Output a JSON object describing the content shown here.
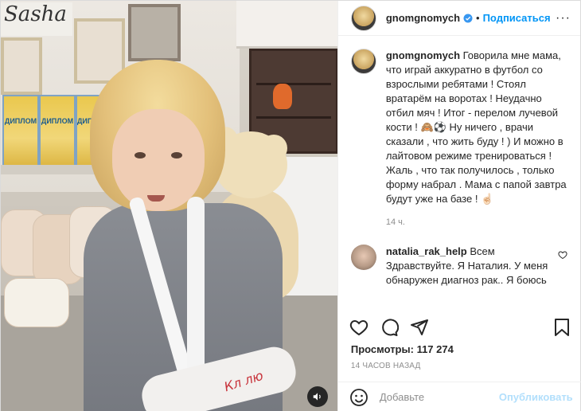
{
  "media": {
    "sign_text": "Sasha",
    "diploma_label": "ДИПЛОМ",
    "cast_text": "Кл лю",
    "sound_icon": "speaker-icon"
  },
  "header": {
    "username": "gnomgnomych",
    "separator": "•",
    "follow_label": "Подписаться",
    "more_label": "···",
    "verified_color": "#3897f0"
  },
  "caption": {
    "username": "gnomgnomych",
    "text": "Говорила мне мама, что играй аккуратно в футбол со взрослыми ребятами ! Стоял вратарём на воротах ! Неудачно отбил мяч ! Итог - перелом лучевой кости ! 🙈⚽️ Ну ничего , врачи сказали , что жить буду ! ) И можно в лайтовом режиме тренироваться ! Жаль , что так получилось , только форму набрал . Мама с папой завтра будут уже на базе ! ☝🏻",
    "time": "14 ч."
  },
  "comments": [
    {
      "username": "natalia_rak_help",
      "text": "Всем Здравствуйте. Я Наталия. У меня обнаружен диагноз рак.. Я боюсь оставить своих детей без матери и борюсь заа жизнь Прошу вас о"
    }
  ],
  "stats": {
    "views_label": "Просмотры:",
    "views_count": "117 274",
    "posted_ago": "14 ЧАСОВ НАЗАД"
  },
  "comment_box": {
    "placeholder": "Добавьте",
    "publish_label": "Опубликовать"
  },
  "colors": {
    "accent": "#0095f6",
    "publish_disabled": "#b2dffc"
  }
}
